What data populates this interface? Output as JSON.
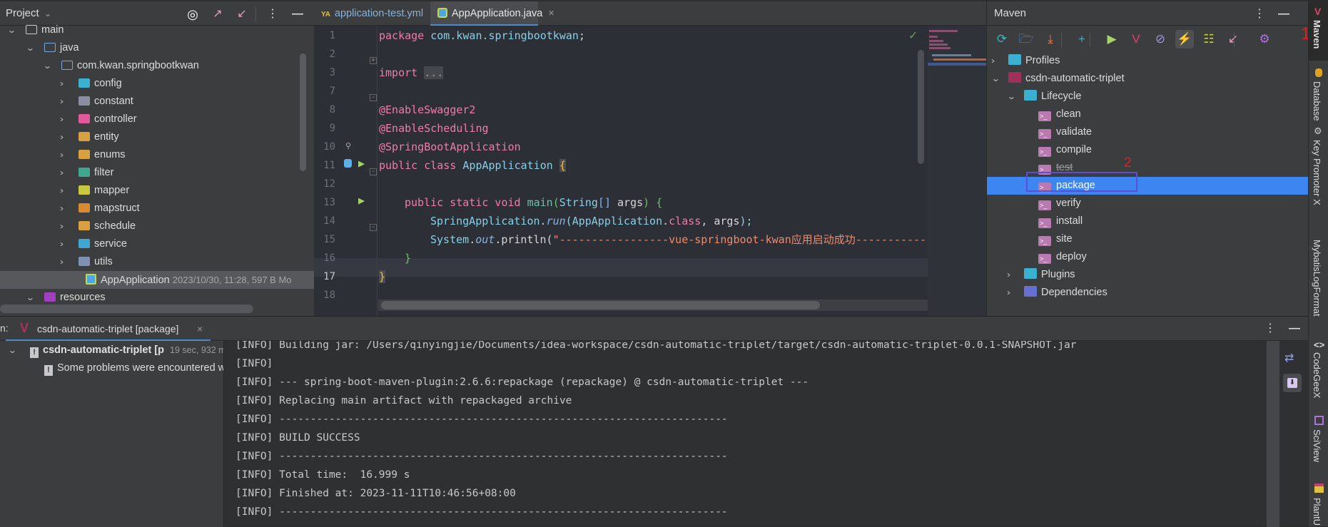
{
  "project": {
    "title": "Project",
    "tree": [
      {
        "label": "main",
        "depth": 0,
        "expanded": true,
        "icon": "folder-icon"
      },
      {
        "label": "java",
        "depth": 1,
        "expanded": true,
        "icon": "source-folder-icon"
      },
      {
        "label": "com.kwan.springbootkwan",
        "depth": 2,
        "expanded": true,
        "icon": "package-icon"
      },
      {
        "label": "config",
        "depth": 3,
        "icon": "config-folder-icon"
      },
      {
        "label": "constant",
        "depth": 3,
        "icon": "constant-folder-icon"
      },
      {
        "label": "controller",
        "depth": 3,
        "icon": "controller-folder-icon"
      },
      {
        "label": "entity",
        "depth": 3,
        "icon": "entity-folder-icon"
      },
      {
        "label": "enums",
        "depth": 3,
        "icon": "enums-folder-icon"
      },
      {
        "label": "filter",
        "depth": 3,
        "icon": "filter-folder-icon"
      },
      {
        "label": "mapper",
        "depth": 3,
        "icon": "mapper-folder-icon"
      },
      {
        "label": "mapstruct",
        "depth": 3,
        "icon": "mapstruct-folder-icon"
      },
      {
        "label": "schedule",
        "depth": 3,
        "icon": "schedule-folder-icon"
      },
      {
        "label": "service",
        "depth": 3,
        "icon": "service-folder-icon"
      },
      {
        "label": "utils",
        "depth": 3,
        "icon": "utils-folder-icon"
      },
      {
        "label": "AppApplication",
        "meta": "2023/10/30, 11:28, 597 B Mo",
        "depth": 4,
        "icon": "spring-boot-class-icon",
        "selected": true
      },
      {
        "label": "resources",
        "depth": 1,
        "expanded": true,
        "icon": "resources-folder-icon"
      }
    ]
  },
  "editor": {
    "tabs": [
      {
        "label": "application-test.yml",
        "icon": "yaml-icon",
        "active": false
      },
      {
        "label": "AppApplication.java",
        "icon": "spring-boot-class-icon",
        "active": true
      }
    ],
    "line_numbers": [
      "1",
      "2",
      "3",
      "7",
      "8",
      "9",
      "10",
      "11",
      "12",
      "13",
      "14",
      "15",
      "16",
      "17",
      "18"
    ],
    "current_line": "17",
    "code": {
      "l1_kw": "package",
      "l1_pkg": "com.kwan.springbootkwan",
      "l1_semi": ";",
      "l3_kw": "import",
      "l3_fold": "...",
      "l8": "@EnableSwagger2",
      "l9": "@EnableScheduling",
      "l10": "@SpringBootApplication",
      "l11_kw": "public class",
      "l11_name": "AppApplication",
      "l11_brace": "{",
      "l13_kw": "public static void",
      "l13_m": "main",
      "l13_p1": "(",
      "l13_type": "String",
      "l13_arr": "[]",
      "l13_arg": " args",
      "l13_p2": ")",
      "l13_brace": "{",
      "l14_cls": "SpringApplication",
      "l14_dot": ".",
      "l14_m": "run",
      "l14_p1": "(",
      "l14_cls2": "AppApplication",
      "l14_dot2": ".",
      "l14_kw": "class",
      "l14_rest": ", args",
      "l14_end": ");",
      "l15_cls": "System",
      "l15_dot": ".",
      "l15_f": "out",
      "l15_m": ".println(",
      "l15_str": "\"-----------------vue-springboot-kwan应用启动成功-----------",
      "l16": "}",
      "l17": "}"
    }
  },
  "maven": {
    "title": "Maven",
    "toolbar": [
      "reload-icon",
      "reimport-folder-icon",
      "download-icon",
      "add-icon",
      "run-icon",
      "execute-maven-goal-icon",
      "toggle-offline-icon",
      "skip-tests-icon",
      "show-dependencies-icon",
      "collapse-all-icon",
      "settings-icon"
    ],
    "tree": [
      {
        "label": "Profiles",
        "depth": 0,
        "expanded": false
      },
      {
        "label": "csdn-automatic-triplet",
        "depth": 0,
        "expanded": true
      },
      {
        "label": "Lifecycle",
        "depth": 1,
        "expanded": true
      },
      {
        "label": "clean",
        "depth": 2
      },
      {
        "label": "validate",
        "depth": 2
      },
      {
        "label": "compile",
        "depth": 2
      },
      {
        "label": "test",
        "depth": 2,
        "disabled": true
      },
      {
        "label": "package",
        "depth": 2,
        "selected": true
      },
      {
        "label": "verify",
        "depth": 2
      },
      {
        "label": "install",
        "depth": 2
      },
      {
        "label": "site",
        "depth": 2
      },
      {
        "label": "deploy",
        "depth": 2
      },
      {
        "label": "Plugins",
        "depth": 1,
        "expanded": false
      },
      {
        "label": "Dependencies",
        "depth": 1,
        "expanded": false
      }
    ],
    "annotation_1": "1",
    "annotation_2": "2",
    "selection_color": "#3d85f0"
  },
  "right_strip": [
    "Maven",
    "Database",
    "Key Promoter X",
    "MybatisLogFormat",
    "CodeGeeX",
    "SciView",
    "PlantU"
  ],
  "run": {
    "prefix": "n:",
    "tab_label": "csdn-automatic-triplet [package]",
    "tree_root": "csdn-automatic-triplet [p",
    "tree_root_time": "19 sec, 932 ms",
    "tree_child": "Some problems were encountered w",
    "console": [
      "[INFO] Building jar: /Users/qinyingjie/Documents/idea-workspace/csdn-automatic-triplet/target/csdn-automatic-triplet-0.0.1-SNAPSHOT.jar",
      "[INFO]",
      "[INFO] --- spring-boot-maven-plugin:2.6.6:repackage (repackage) @ csdn-automatic-triplet ---",
      "[INFO] Replacing main artifact with repackaged archive",
      "[INFO] ------------------------------------------------------------------------",
      "[INFO] BUILD SUCCESS",
      "[INFO] ------------------------------------------------------------------------",
      "[INFO] Total time:  16.999 s",
      "[INFO] Finished at: 2023-11-11T10:46:56+08:00",
      "[INFO] ------------------------------------------------------------------------"
    ]
  }
}
